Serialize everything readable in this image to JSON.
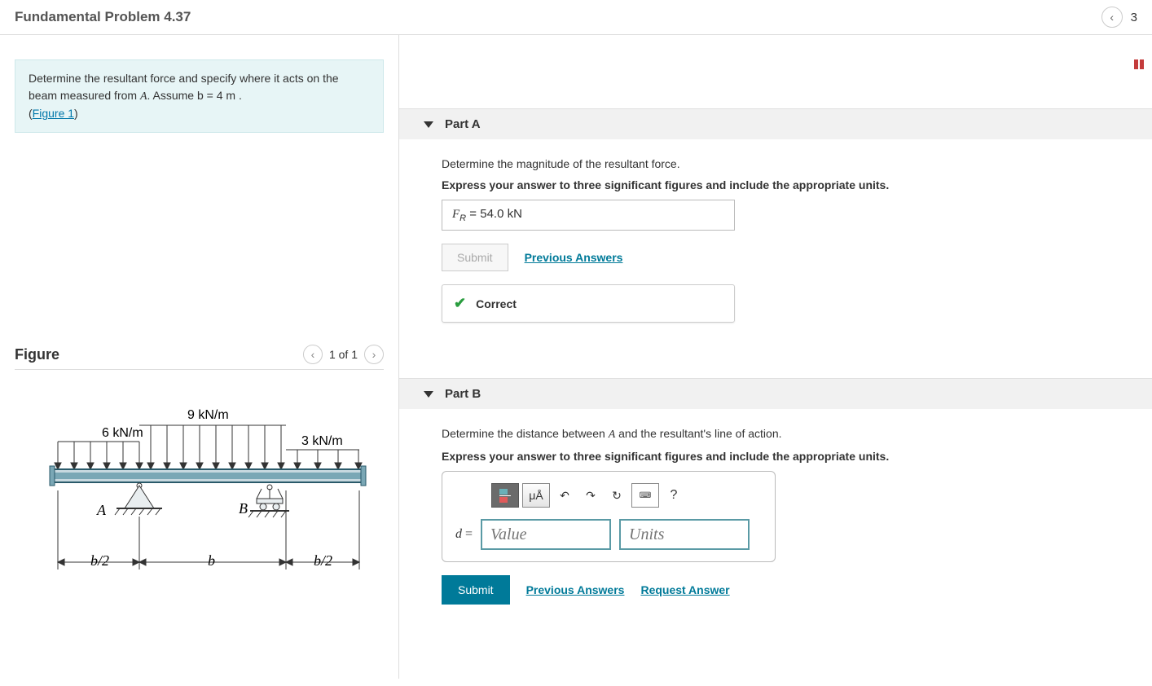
{
  "header": {
    "title": "Fundamental Problem 4.37",
    "page": "3"
  },
  "problem": {
    "line1_prefix": "Determine the resultant force and specify where it acts on the beam measured from ",
    "line1_var": "A",
    "line1_suffix": ". Assume b = 4 m .",
    "figure_link": "Figure 1"
  },
  "figure": {
    "title": "Figure",
    "counter": "1 of 1",
    "labels": {
      "load_left": "6 kN/m",
      "load_mid": "9 kN/m",
      "load_right": "3 kN/m",
      "ptA": "A",
      "ptB": "B",
      "dim1": "b/2",
      "dim2": "b",
      "dim3": "b/2"
    }
  },
  "partA": {
    "title": "Part A",
    "q1": "Determine the magnitude of the resultant force.",
    "q2": "Express your answer to three significant figures and include the appropriate units.",
    "answer_var": "F",
    "answer_sub": "R",
    "answer_eq": " = ",
    "answer_value": "54.0 kN",
    "submit": "Submit",
    "prev": "Previous Answers",
    "feedback": "Correct"
  },
  "partB": {
    "title": "Part B",
    "q1_prefix": "Determine the distance between ",
    "q1_var": "A",
    "q1_suffix": " and the resultant's line of action.",
    "q2": "Express your answer to three significant figures and include the appropriate units.",
    "var": "d",
    "eq": " = ",
    "value_placeholder": "Value",
    "units_placeholder": "Units",
    "tool_mu": "μÅ",
    "tool_help": "?",
    "submit": "Submit",
    "prev": "Previous Answers",
    "request": "Request Answer"
  }
}
